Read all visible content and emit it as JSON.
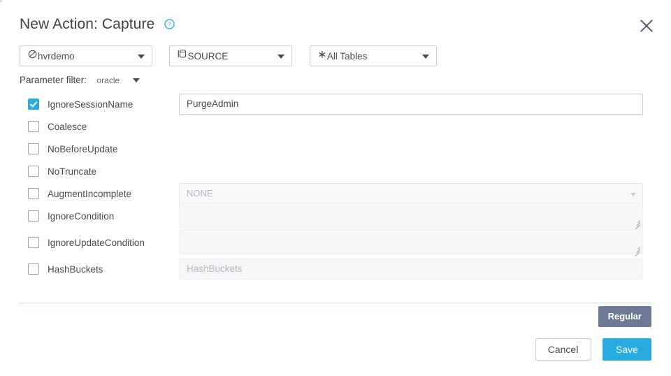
{
  "dialog": {
    "title": "New Action: Capture",
    "help_icon": "help-circle-icon",
    "close_icon": "close-icon"
  },
  "selectors": [
    {
      "icon": "channel-icon",
      "label": "hvrdemo"
    },
    {
      "icon": "database-icon",
      "label": "SOURCE"
    },
    {
      "icon": "asterisk-icon",
      "label": "All Tables"
    }
  ],
  "parameter_filter": {
    "label": "Parameter filter:",
    "value": "oracle"
  },
  "parameters": [
    {
      "name": "IgnoreSessionName",
      "checked": true,
      "field_type": "text",
      "value": "PurgeAdmin",
      "disabled": false
    },
    {
      "name": "Coalesce",
      "checked": false,
      "field_type": "none",
      "value": "",
      "disabled": true
    },
    {
      "name": "NoBeforeUpdate",
      "checked": false,
      "field_type": "none",
      "value": "",
      "disabled": true
    },
    {
      "name": "NoTruncate",
      "checked": false,
      "field_type": "none",
      "value": "",
      "disabled": true
    },
    {
      "name": "AugmentIncomplete",
      "checked": false,
      "field_type": "select",
      "value": "NONE",
      "disabled": true
    },
    {
      "name": "IgnoreCondition",
      "checked": false,
      "field_type": "textarea",
      "value": "",
      "disabled": true
    },
    {
      "name": "IgnoreUpdateCondition",
      "checked": false,
      "field_type": "textarea",
      "value": "",
      "disabled": true
    },
    {
      "name": "HashBuckets",
      "checked": false,
      "field_type": "input",
      "value": "HashBuckets",
      "disabled": true
    }
  ],
  "footer": {
    "regular_label": "Regular",
    "cancel_label": "Cancel",
    "save_label": "Save"
  },
  "colors": {
    "accent": "#29abe2",
    "regular_button": "#6d7a95",
    "border": "#c9ced6",
    "disabled_bg": "#f5f6f8",
    "disabled_text": "#b4b9c1"
  }
}
